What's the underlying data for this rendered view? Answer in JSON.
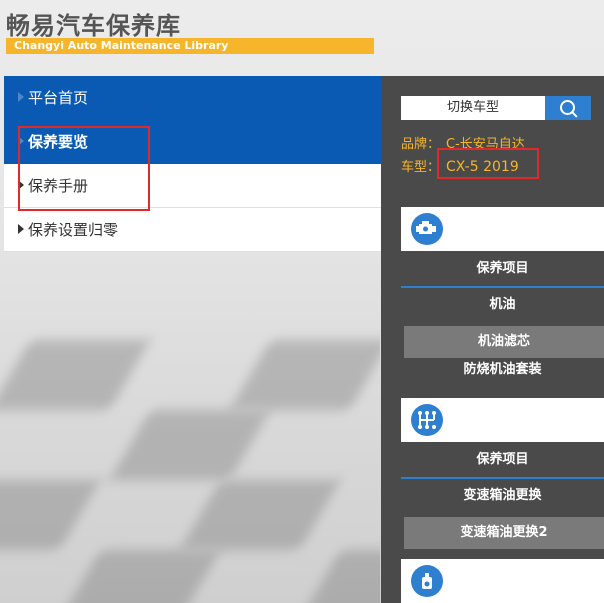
{
  "header": {
    "title": "畅易汽车保养库",
    "subtitle": "Changyi Auto Maintenance Library"
  },
  "menu": {
    "items": [
      {
        "label": "平台首页"
      },
      {
        "label": "保养要览"
      },
      {
        "label": "保养手册"
      },
      {
        "label": "保养设置归零"
      }
    ]
  },
  "panel": {
    "switch_label": "切换车型",
    "brand_label": "品牌：",
    "brand_value": "C-长安马自达",
    "model_label": "车型：",
    "model_value": "CX-5 2019",
    "section1": {
      "icon": "engine-icon",
      "title": "保养项目",
      "rows": [
        "机油",
        "机油滤芯",
        "防烧机油套装"
      ]
    },
    "section2": {
      "icon": "gearbox-icon",
      "title": "保养项目",
      "rows": [
        "变速箱油更换",
        "变速箱油更换2"
      ]
    },
    "section3": {
      "icon": "oil-bottle-icon"
    }
  },
  "colors": {
    "primary_blue": "#0a5ab3",
    "accent_yellow": "#f6b52a",
    "panel_gray": "#4a4a4a",
    "highlight_red": "#e02a2a"
  }
}
